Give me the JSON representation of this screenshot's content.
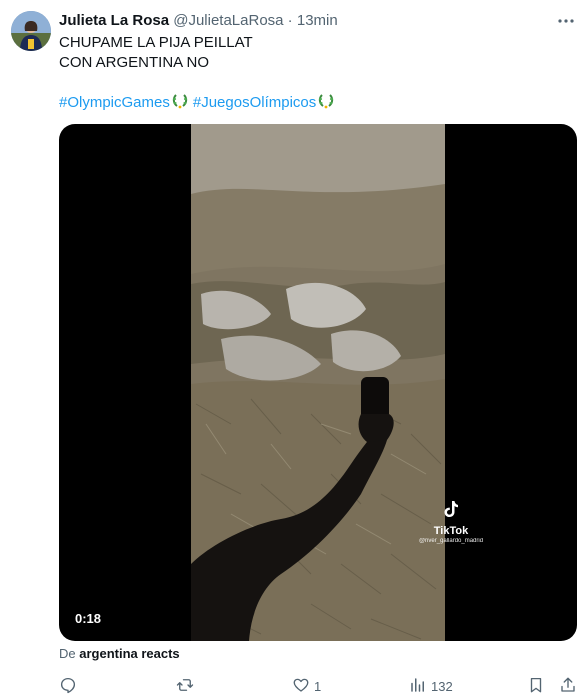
{
  "tweet": {
    "author_name": "Julieta La Rosa",
    "author_handle": "@JulietaLaRosa",
    "separator": " · ",
    "time": "13min",
    "text_lines": [
      "CHUPAME LA PIJA PEILLAT",
      "CON ARGENTINA NO"
    ],
    "hashtags": [
      "#OlympicGames",
      "#JuegosOlímpicos"
    ]
  },
  "media": {
    "duration": "0:18",
    "watermark": "TikTok",
    "watermark_user": "@river_gallardo_madrid"
  },
  "source": {
    "prefix": "De ",
    "name": "argentina reacts"
  },
  "actions": {
    "reply_count": "",
    "retweet_count": "",
    "like_count": "1",
    "view_count": "132"
  },
  "colors": {
    "accent": "#1d9bf0",
    "secondary_text": "#536471",
    "primary_text": "#0f1419"
  },
  "icons": [
    "more-icon",
    "laurel-icon",
    "tiktok-icon",
    "reply-icon",
    "retweet-icon",
    "like-icon",
    "views-icon",
    "bookmark-icon",
    "share-icon"
  ]
}
